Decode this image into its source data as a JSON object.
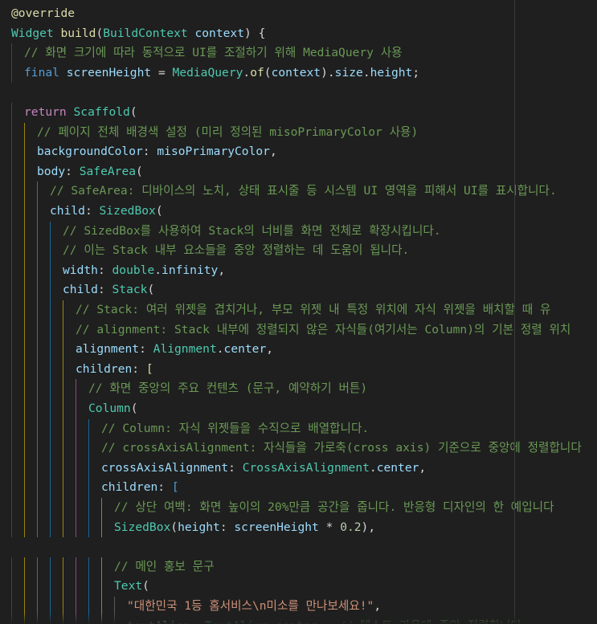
{
  "editor": {
    "theme": {
      "background": "#1f1f1f",
      "ruler": "#3a3a3a"
    },
    "colors": {
      "plain": "#d4d4d4",
      "keyword": "#c586c0",
      "storage": "#569cd6",
      "type": "#4ec9b0",
      "func": "#dcdcaa",
      "var": "#9cdcfe",
      "comment": "#6a9955",
      "string": "#ce9178",
      "number": "#b5cea8",
      "ann": "#dcdcaa"
    },
    "guide_colors": [
      "#8a8a8a",
      "#ffd700",
      "#da70d6",
      "#179fff",
      "#ffd700",
      "#da70d6",
      "#179fff",
      "#ffd700"
    ],
    "lines": [
      {
        "indent": 0,
        "tokens": [
          [
            "@override",
            "ann"
          ]
        ]
      },
      {
        "indent": 0,
        "tokens": [
          [
            "Widget",
            "type"
          ],
          [
            " ",
            "plain"
          ],
          [
            "build",
            "func"
          ],
          [
            "(",
            "plain"
          ],
          [
            "BuildContext",
            "type"
          ],
          [
            " ",
            "plain"
          ],
          [
            "context",
            "var"
          ],
          [
            ") {",
            "plain"
          ]
        ]
      },
      {
        "indent": 1,
        "tokens": [
          [
            "// 화면 크기에 따라 동적으로 UI를 조절하기 위해 MediaQuery 사용",
            "comment"
          ]
        ]
      },
      {
        "indent": 1,
        "tokens": [
          [
            "final",
            "storage"
          ],
          [
            " ",
            "plain"
          ],
          [
            "screenHeight",
            "var"
          ],
          [
            " = ",
            "plain"
          ],
          [
            "MediaQuery",
            "type"
          ],
          [
            ".",
            "plain"
          ],
          [
            "of",
            "func"
          ],
          [
            "(",
            "plain"
          ],
          [
            "context",
            "var"
          ],
          [
            ").",
            "plain"
          ],
          [
            "size",
            "var"
          ],
          [
            ".",
            "plain"
          ],
          [
            "height",
            "var"
          ],
          [
            ";",
            "plain"
          ]
        ]
      },
      {
        "indent": 0,
        "tokens": []
      },
      {
        "indent": 1,
        "tokens": [
          [
            "return",
            "keyword"
          ],
          [
            " ",
            "plain"
          ],
          [
            "Scaffold",
            "type"
          ],
          [
            "(",
            "plain"
          ]
        ]
      },
      {
        "indent": 2,
        "tokens": [
          [
            "// 페이지 전체 배경색 설정 (미리 정의된 misoPrimaryColor 사용)",
            "comment"
          ]
        ]
      },
      {
        "indent": 2,
        "tokens": [
          [
            "backgroundColor",
            "var"
          ],
          [
            ": ",
            "plain"
          ],
          [
            "misoPrimaryColor",
            "var"
          ],
          [
            ",",
            "plain"
          ]
        ]
      },
      {
        "indent": 2,
        "tokens": [
          [
            "body",
            "var"
          ],
          [
            ": ",
            "plain"
          ],
          [
            "SafeArea",
            "type"
          ],
          [
            "(",
            "plain"
          ]
        ]
      },
      {
        "indent": 3,
        "tokens": [
          [
            "// SafeArea: 디바이스의 노치, 상태 표시줄 등 시스템 UI 영역을 피해서 UI를 표시합니다.",
            "comment"
          ]
        ]
      },
      {
        "indent": 3,
        "tokens": [
          [
            "child",
            "var"
          ],
          [
            ": ",
            "plain"
          ],
          [
            "SizedBox",
            "type"
          ],
          [
            "(",
            "plain"
          ]
        ]
      },
      {
        "indent": 4,
        "tokens": [
          [
            "// SizedBox를 사용하여 Stack의 너비를 화면 전체로 확장시킵니다.",
            "comment"
          ]
        ]
      },
      {
        "indent": 4,
        "tokens": [
          [
            "// 이는 Stack 내부 요소들을 중앙 정렬하는 데 도움이 됩니다.",
            "comment"
          ]
        ]
      },
      {
        "indent": 4,
        "tokens": [
          [
            "width",
            "var"
          ],
          [
            ": ",
            "plain"
          ],
          [
            "double",
            "type"
          ],
          [
            ".",
            "plain"
          ],
          [
            "infinity",
            "var"
          ],
          [
            ",",
            "plain"
          ]
        ]
      },
      {
        "indent": 4,
        "tokens": [
          [
            "child",
            "var"
          ],
          [
            ": ",
            "plain"
          ],
          [
            "Stack",
            "type"
          ],
          [
            "(",
            "plain"
          ]
        ]
      },
      {
        "indent": 5,
        "tokens": [
          [
            "// Stack: 여러 위젯을 겹치거나, 부모 위젯 내 특정 위치에 자식 위젯을 배치할 때 유",
            "comment"
          ]
        ]
      },
      {
        "indent": 5,
        "tokens": [
          [
            "// alignment: Stack 내부에 정렬되지 않은 자식들(여기서는 Column)의 기본 정렬 위치",
            "comment"
          ]
        ]
      },
      {
        "indent": 5,
        "tokens": [
          [
            "alignment",
            "var"
          ],
          [
            ": ",
            "plain"
          ],
          [
            "Alignment",
            "type"
          ],
          [
            ".",
            "plain"
          ],
          [
            "center",
            "var"
          ],
          [
            ",",
            "plain"
          ]
        ]
      },
      {
        "indent": 5,
        "tokens": [
          [
            "children",
            "var"
          ],
          [
            ": ",
            "plain"
          ],
          [
            "[",
            "ann"
          ]
        ]
      },
      {
        "indent": 6,
        "tokens": [
          [
            "// 화면 중앙의 주요 컨텐츠 (문구, 예약하기 버튼)",
            "comment"
          ]
        ]
      },
      {
        "indent": 6,
        "tokens": [
          [
            "Column",
            "type"
          ],
          [
            "(",
            "plain"
          ]
        ]
      },
      {
        "indent": 7,
        "tokens": [
          [
            "// Column: 자식 위젯들을 수직으로 배열합니다.",
            "comment"
          ]
        ]
      },
      {
        "indent": 7,
        "tokens": [
          [
            "// crossAxisAlignment: 자식들을 가로축(cross axis) 기준으로 중앙에 정렬합니다",
            "comment"
          ]
        ]
      },
      {
        "indent": 7,
        "tokens": [
          [
            "crossAxisAlignment",
            "var"
          ],
          [
            ": ",
            "plain"
          ],
          [
            "CrossAxisAlignment",
            "type"
          ],
          [
            ".",
            "plain"
          ],
          [
            "center",
            "var"
          ],
          [
            ",",
            "plain"
          ]
        ]
      },
      {
        "indent": 7,
        "tokens": [
          [
            "children",
            "var"
          ],
          [
            ": ",
            "plain"
          ],
          [
            "[",
            "storage"
          ]
        ]
      },
      {
        "indent": 8,
        "tokens": [
          [
            "// 상단 여백: 화면 높이의 20%만큼 공간을 줍니다. 반응형 디자인의 한 예입니다",
            "comment"
          ]
        ]
      },
      {
        "indent": 8,
        "tokens": [
          [
            "SizedBox",
            "type"
          ],
          [
            "(",
            "plain"
          ],
          [
            "height",
            "var"
          ],
          [
            ": ",
            "plain"
          ],
          [
            "screenHeight",
            "var"
          ],
          [
            " * ",
            "plain"
          ],
          [
            "0.2",
            "number"
          ],
          [
            "),",
            "plain"
          ]
        ]
      },
      {
        "indent": 0,
        "tokens": []
      },
      {
        "indent": 8,
        "tokens": [
          [
            "// 메인 홍보 문구",
            "comment"
          ]
        ]
      },
      {
        "indent": 8,
        "tokens": [
          [
            "Text",
            "type"
          ],
          [
            "(",
            "plain"
          ]
        ]
      },
      {
        "indent": 9,
        "tokens": [
          [
            "\"대한민국 1등 홈서비스\\n미소를 만나보세요!\"",
            "string"
          ],
          [
            ",",
            "plain"
          ]
        ]
      },
      {
        "indent": 9,
        "tokens": [
          [
            "textAlign",
            "var"
          ],
          [
            ": ",
            "plain"
          ],
          [
            "TextAlign",
            "type"
          ],
          [
            ".",
            "plain"
          ],
          [
            "center",
            "var"
          ],
          [
            ",  ",
            "plain"
          ],
          [
            "// 텍스트 가운데 중앙 정렬합니다",
            "comment"
          ]
        ]
      }
    ]
  }
}
